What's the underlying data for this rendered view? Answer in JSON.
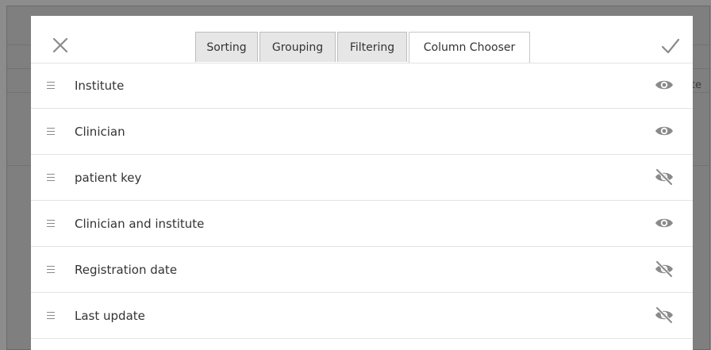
{
  "background": {
    "peek_text": "te"
  },
  "modal": {
    "tabs": [
      {
        "label": "Sorting",
        "active": false
      },
      {
        "label": "Grouping",
        "active": false
      },
      {
        "label": "Filtering",
        "active": false
      },
      {
        "label": "Column Chooser",
        "active": true
      }
    ],
    "columns": [
      {
        "label": "Institute",
        "visible": true,
        "icon": "eye-icon"
      },
      {
        "label": "Clinician",
        "visible": true,
        "icon": "eye-icon"
      },
      {
        "label": "patient key",
        "visible": false,
        "icon": "eye-off-icon"
      },
      {
        "label": "Clinician and institute",
        "visible": true,
        "icon": "eye-icon"
      },
      {
        "label": "Registration date",
        "visible": false,
        "icon": "eye-off-icon"
      },
      {
        "label": "Last update",
        "visible": false,
        "icon": "eye-off-icon"
      }
    ],
    "colors": {
      "icon_gray": "#8a8a8a",
      "overlay": "#7f7f7f",
      "tab_inactive": "#e6e6e6"
    }
  }
}
